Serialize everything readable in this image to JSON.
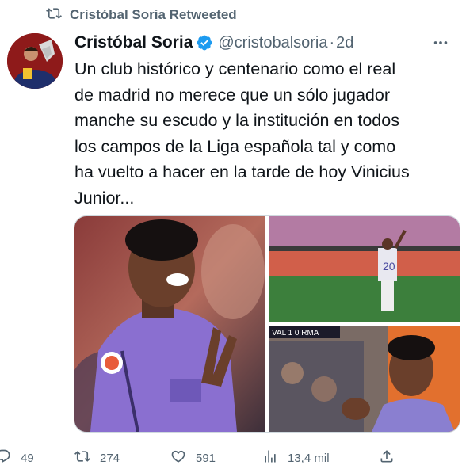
{
  "retweet": {
    "label": "Cristóbal Soria Retweeted"
  },
  "tweet": {
    "name": "Cristóbal Soria",
    "handle": "@cristobalsoria",
    "separator": "·",
    "time": "2d",
    "text": "Un club histórico y centenario como el real\nde madrid no merece que un sólo jugador\nmanche su escudo y la institución en todos\nlos campos de la Liga española tal y como\nha vuelto a hacer en la tarde de hoy Vinicius\nJunior..."
  },
  "media": {
    "scoreboard": "VAL 1 0 RMA"
  },
  "actions": {
    "replies": "49",
    "retweets": "274",
    "likes": "591",
    "views": "13,4 mil"
  },
  "colors": {
    "text": "#0f1419",
    "secondary": "#536471",
    "verified": "#1d9bf0"
  }
}
